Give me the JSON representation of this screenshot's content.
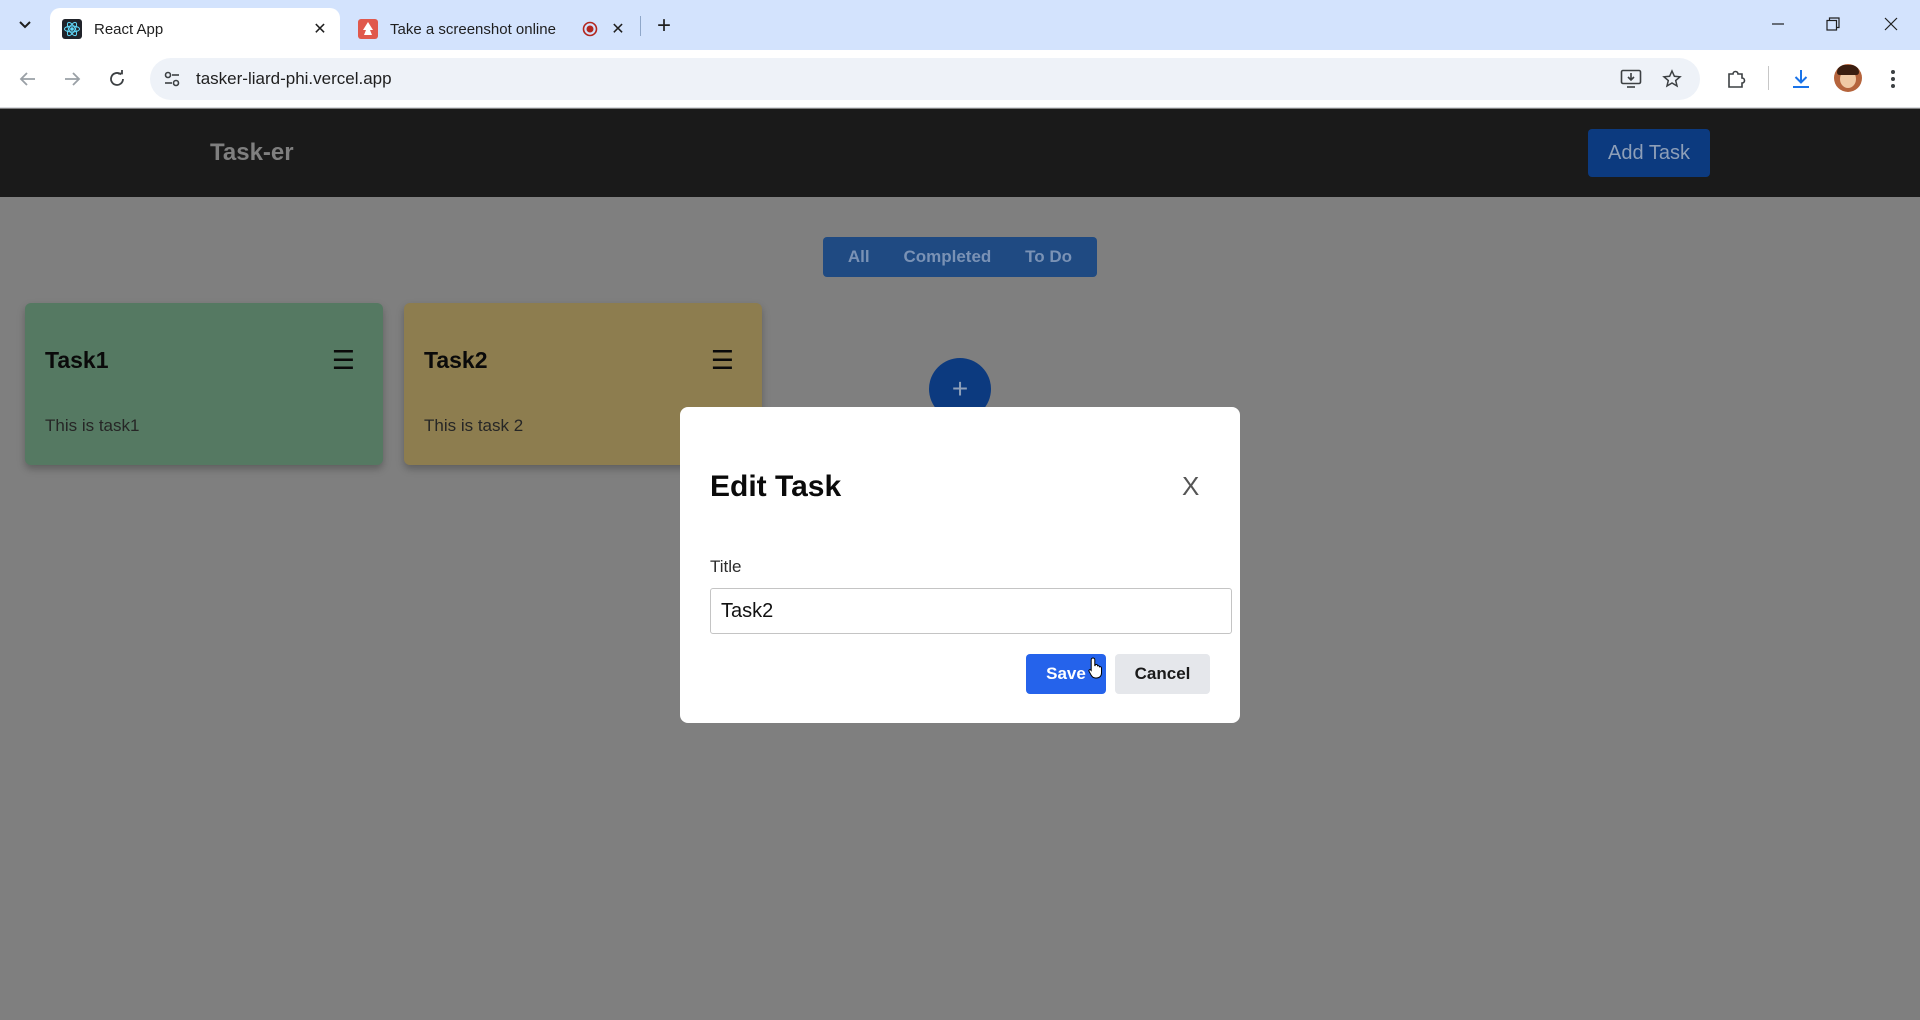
{
  "browser": {
    "tabs": [
      {
        "title": "React App",
        "active": true,
        "favicon": "react-icon"
      },
      {
        "title": "Take a screenshot online",
        "active": false,
        "favicon": "screenshot-icon",
        "recording": true
      }
    ],
    "url": "tasker-liard-phi.vercel.app"
  },
  "app": {
    "brand": "Task-er",
    "add_task_label": "Add Task",
    "filters": [
      "All",
      "Completed",
      "To Do"
    ],
    "tasks": [
      {
        "title": "Task1",
        "description": "This is task1",
        "color": "#557962"
      },
      {
        "title": "Task2",
        "description": "This is task 2",
        "color": "#8d7d4f"
      }
    ],
    "fab_label": "+"
  },
  "modal": {
    "title": "Edit Task",
    "close_label": "X",
    "field_label": "Title",
    "title_value": "Task2",
    "save_label": "Save",
    "cancel_label": "Cancel"
  },
  "colors": {
    "primary": "#2563eb",
    "overlay": "#7f7f7f",
    "header": "#1a1a1a"
  }
}
